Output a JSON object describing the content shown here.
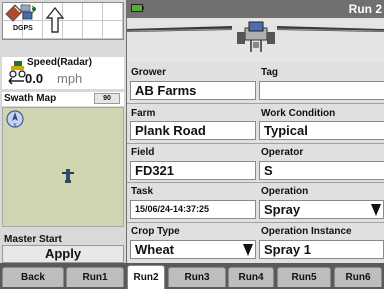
{
  "status": {
    "dgps_label": "DGPS",
    "icons": [
      "satellite-icon",
      "nav-up-icon"
    ]
  },
  "speed": {
    "label": "Speed(Radar)",
    "value": "0.0",
    "unit": "mph"
  },
  "swath": {
    "label": "Swath Map",
    "zoom": "90",
    "icons": [
      "compass-icon",
      "vehicle-marker-icon"
    ]
  },
  "master_start": {
    "label": "Master Start",
    "button": "Apply"
  },
  "header": {
    "title": "Run 2",
    "icons": [
      "battery-icon",
      "sprayer-icon"
    ]
  },
  "form": {
    "grower": {
      "label": "Grower",
      "value": "AB Farms"
    },
    "tag": {
      "label": "Tag",
      "value": ""
    },
    "farm": {
      "label": "Farm",
      "value": "Plank Road"
    },
    "work_condition": {
      "label": "Work Condition",
      "value": "Typical"
    },
    "field": {
      "label": "Field",
      "value": "FD321"
    },
    "operator": {
      "label": "Operator",
      "value": "S"
    },
    "task": {
      "label": "Task",
      "value": "15/06/24-14:37:25"
    },
    "operation": {
      "label": "Operation",
      "value": "Spray"
    },
    "crop_type": {
      "label": "Crop Type",
      "value": "Wheat"
    },
    "operation_instance": {
      "label": "Operation Instance",
      "value": "Spray 1"
    }
  },
  "tabs": [
    "Back",
    "Run1",
    "Run2",
    "Run3",
    "Run4",
    "Run5",
    "Run6"
  ],
  "active_tab": "Run2",
  "colors": {
    "header_bar": "#707070",
    "panel": "#e0e0e0",
    "map": "#cfd5b1",
    "tab_bar": "#5a5a5a"
  }
}
